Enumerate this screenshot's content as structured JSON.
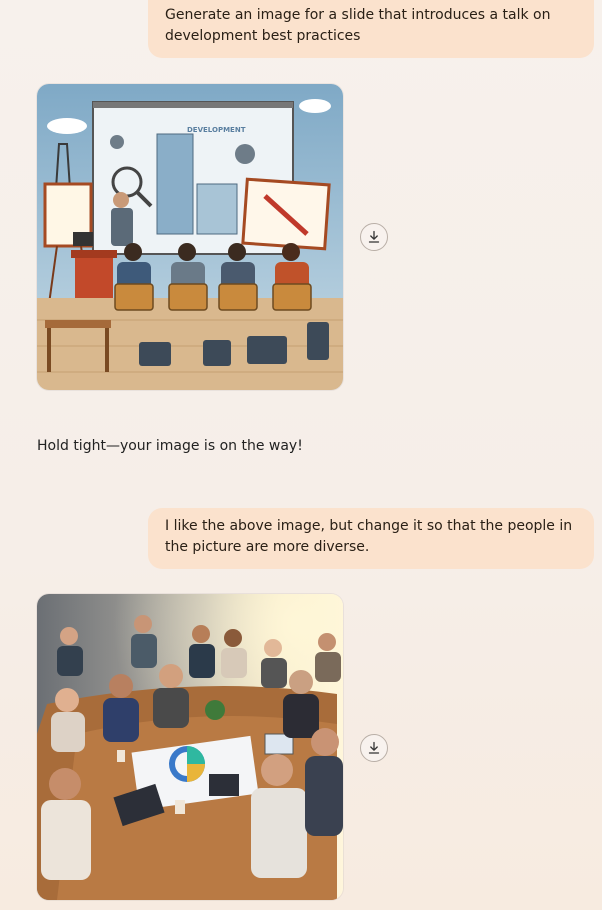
{
  "messages": {
    "user_prompt_1": "Generate an image for a slide that introduces a talk on development best practices",
    "image_1_text": "DEVELOPMENT",
    "status_text": "Hold tight—your image is on the way!",
    "user_prompt_2": "I like the above image, but change it so that the people in the picture are more diverse."
  },
  "icons": {
    "download": "download-icon"
  },
  "colors": {
    "user_bubble": "#fbe2cd",
    "background": "#f7f1ec"
  }
}
